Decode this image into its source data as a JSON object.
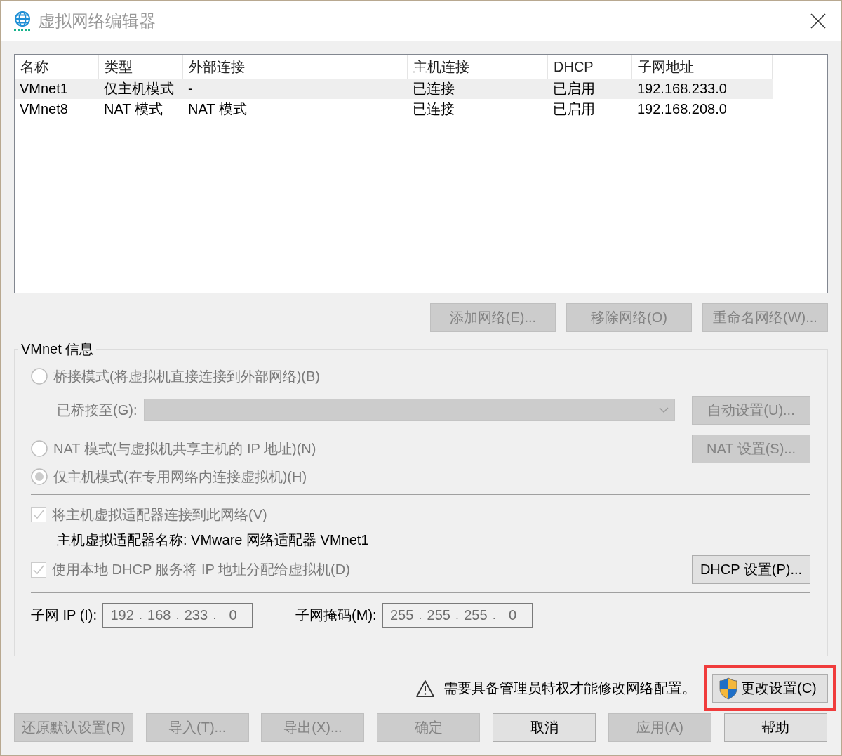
{
  "window": {
    "title": "虚拟网络编辑器"
  },
  "table": {
    "columns": [
      "名称",
      "类型",
      "外部连接",
      "主机连接",
      "DHCP",
      "子网地址"
    ],
    "rows": [
      {
        "cells": [
          "VMnet1",
          "仅主机模式",
          "-",
          "已连接",
          "已启用",
          "192.168.233.0"
        ],
        "selected": true
      },
      {
        "cells": [
          "VMnet8",
          "NAT 模式",
          "NAT 模式",
          "已连接",
          "已启用",
          "192.168.208.0"
        ],
        "selected": false
      }
    ]
  },
  "list_buttons": [
    {
      "label": "添加网络(E)...",
      "disabled": true
    },
    {
      "label": "移除网络(O)",
      "disabled": true
    },
    {
      "label": "重命名网络(W)...",
      "disabled": true
    }
  ],
  "vmnet_info": {
    "title": "VMnet 信息",
    "bridged": {
      "label": "桥接模式(将虚拟机直接连接到外部网络)(B)",
      "selected": false,
      "disabled": true
    },
    "bridged_to": {
      "label": "已桥接至(G):",
      "disabled": true
    },
    "auto_settings": {
      "label": "自动设置(U)...",
      "disabled": true
    },
    "nat": {
      "label": "NAT 模式(与虚拟机共享主机的 IP 地址)(N)",
      "selected": false,
      "disabled": true
    },
    "nat_settings": {
      "label": "NAT 设置(S)...",
      "disabled": true
    },
    "host_only": {
      "label": "仅主机模式(在专用网络内连接虚拟机)(H)",
      "selected": true,
      "disabled": true
    },
    "connect_adapter": {
      "label": "将主机虚拟适配器连接到此网络(V)",
      "checked": true,
      "disabled": true
    },
    "adapter_name": "主机虚拟适配器名称: VMware 网络适配器 VMnet1",
    "use_dhcp": {
      "label": "使用本地 DHCP 服务将 IP 地址分配给虚拟机(D)",
      "checked": true,
      "disabled": true
    },
    "dhcp_settings": {
      "label": "DHCP 设置(P)...",
      "disabled": false
    },
    "subnet_ip": {
      "label": "子网 IP (I):",
      "octets": [
        "192",
        "168",
        "233",
        "0"
      ],
      "separator": "."
    },
    "subnet_mask": {
      "label": "子网掩码(M):",
      "octets": [
        "255",
        "255",
        "255",
        "0"
      ],
      "separator": "."
    }
  },
  "notice": {
    "text": "需要具备管理员特权才能修改网络配置。",
    "button": {
      "label": "更改设置(C)",
      "disabled": false,
      "highlighted": true
    }
  },
  "footer_buttons": [
    {
      "label": "还原默认设置(R)",
      "disabled": true
    },
    {
      "label": "导入(T)...",
      "disabled": true
    },
    {
      "label": "导出(X)...",
      "disabled": true
    },
    {
      "label": "确定",
      "disabled": true
    },
    {
      "label": "取消",
      "disabled": false
    },
    {
      "label": "应用(A)",
      "disabled": true
    },
    {
      "label": "帮助",
      "disabled": false
    }
  ]
}
